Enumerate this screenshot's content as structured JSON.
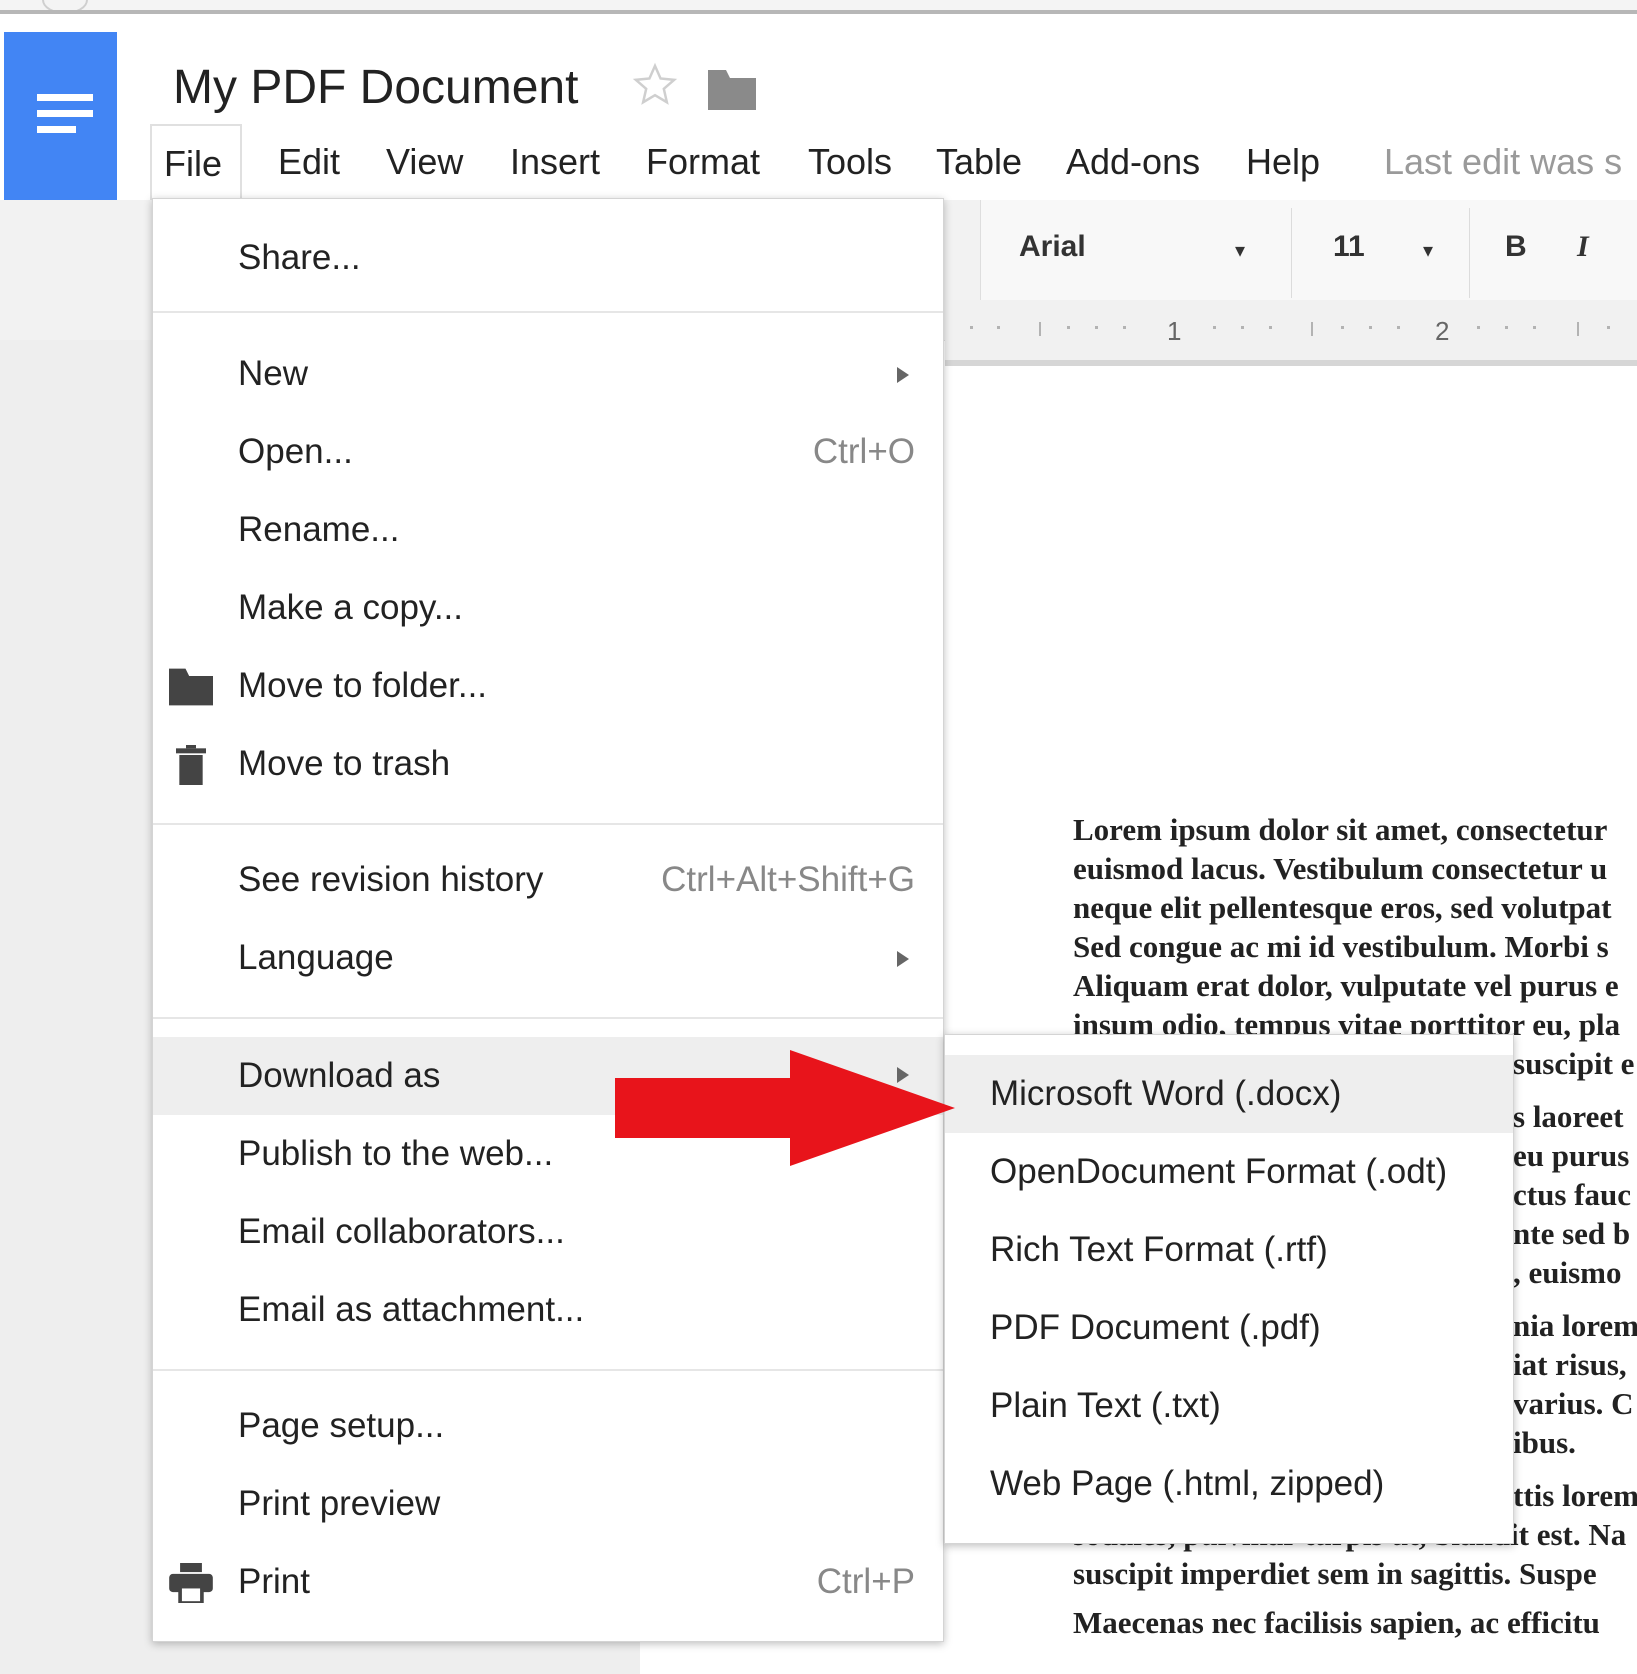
{
  "doc": {
    "title": "My PDF Document"
  },
  "menubar": {
    "items": [
      "File",
      "Edit",
      "View",
      "Insert",
      "Format",
      "Tools",
      "Table",
      "Add-ons",
      "Help"
    ],
    "last_edit": "Last edit was s"
  },
  "toolbar": {
    "font": "Arial",
    "size": "11",
    "bold": "B",
    "italic": "I"
  },
  "ruler": {
    "labels": [
      "1",
      "2"
    ]
  },
  "file_menu": {
    "share": "Share...",
    "new": "New",
    "open": "Open...",
    "open_shortcut": "Ctrl+O",
    "rename": "Rename...",
    "make_copy": "Make a copy...",
    "move_to_folder": "Move to folder...",
    "move_to_trash": "Move to trash",
    "revision_history": "See revision history",
    "revision_shortcut": "Ctrl+Alt+Shift+G",
    "language": "Language",
    "download_as": "Download as",
    "publish": "Publish to the web...",
    "email_collab": "Email collaborators...",
    "email_attach": "Email as attachment...",
    "page_setup": "Page setup...",
    "print_preview": "Print preview",
    "print": "Print",
    "print_shortcut": "Ctrl+P"
  },
  "download_submenu": {
    "items": [
      "Microsoft Word (.docx)",
      "OpenDocument Format (.odt)",
      "Rich Text Format (.rtf)",
      "PDF Document (.pdf)",
      "Plain Text (.txt)",
      "Web Page (.html, zipped)"
    ]
  },
  "document_text": {
    "lines": [
      "Lorem ipsum dolor sit amet, consectetur",
      "euismod lacus. Vestibulum consectetur u",
      "neque elit pellentesque eros, sed volutpat",
      "Sed congue ac mi id vestibulum. Morbi s",
      "Aliquam erat dolor, vulputate vel purus e",
      "insum odio, tempus vitae porttitor eu, pla",
      "suscipit e",
      "s laoreet",
      "eu purus",
      "ctus fauc",
      "nte sed b",
      ", euismo",
      "nia lorem",
      "iat risus,",
      "varius. C",
      "ibus.",
      "ttis lorem",
      "sodales, pulvinar turpis ut, blandit est. Na",
      "suscipit imperdiet sem in sagittis. Suspe"
    ],
    "para2": "Maecenas nec facilisis sapien, ac efficitu"
  },
  "colors": {
    "docs_blue": "#4285f4",
    "arrow_red": "#e8141b"
  },
  "icons": [
    "docs-menu-icon",
    "star-icon",
    "folder-icon",
    "move-folder-icon",
    "trash-icon",
    "print-icon",
    "submenu-arrow-icon",
    "red-arrow"
  ]
}
